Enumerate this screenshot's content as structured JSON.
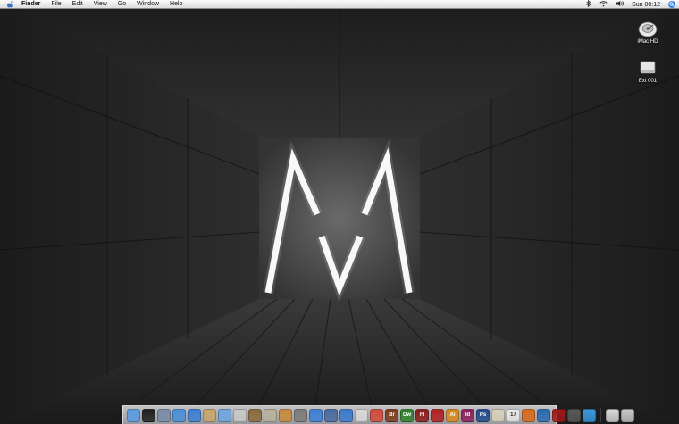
{
  "menubar": {
    "items": [
      "Finder",
      "File",
      "Edit",
      "View",
      "Go",
      "Window",
      "Help"
    ],
    "clock": "Sun 00:12"
  },
  "desktop": {
    "icons": [
      {
        "label": "iMac HD",
        "icon": "hard-drive-icon"
      },
      {
        "label": "Ext 001",
        "icon": "external-drive-icon"
      }
    ]
  },
  "dock": {
    "apps": [
      {
        "icon": "finder-icon",
        "color": "#5a9be0"
      },
      {
        "icon": "dashboard-icon",
        "color": "#1d1d1d"
      },
      {
        "icon": "preview-icon",
        "color": "#7a8aa8"
      },
      {
        "icon": "safari-icon",
        "color": "#4a8fd8"
      },
      {
        "icon": "ichat-icon",
        "color": "#3b7fd4"
      },
      {
        "icon": "address-book-icon",
        "color": "#caa56a"
      },
      {
        "icon": "itunes-icon",
        "color": "#6fa6e0"
      },
      {
        "icon": "textedit-icon",
        "color": "#c9c9c9"
      },
      {
        "icon": "iphoto-icon",
        "color": "#8a6a3a"
      },
      {
        "icon": "imovie-icon",
        "color": "#b8b29a"
      },
      {
        "icon": "garageband-icon",
        "color": "#c98a3a"
      },
      {
        "icon": "system-preferences-icon",
        "color": "#7c7c7c"
      },
      {
        "icon": "itunes-note-icon",
        "color": "#3d7fd6"
      },
      {
        "icon": "app-store-icon",
        "color": "#4a6aa0"
      },
      {
        "icon": "quicktime-icon",
        "color": "#3a7acc"
      },
      {
        "icon": "script-editor-icon",
        "color": "#d8d8d8"
      },
      {
        "icon": "pdf-icon",
        "color": "#d24a3a",
        "label": ""
      },
      {
        "icon": "bridge-icon",
        "color": "#7a3a1a",
        "label": "Br"
      },
      {
        "icon": "dreamweaver-icon",
        "color": "#2f7f2a",
        "label": "Dw"
      },
      {
        "icon": "flash-icon",
        "color": "#8a1a1a",
        "label": "Fl"
      },
      {
        "icon": "acrobat-icon",
        "color": "#b02020",
        "label": ""
      },
      {
        "icon": "illustrator-icon",
        "color": "#d68a1a",
        "label": "Ai"
      },
      {
        "icon": "indesign-icon",
        "color": "#8a1f5a",
        "label": "Id"
      },
      {
        "icon": "photoshop-icon",
        "color": "#1f4a8a",
        "label": "Ps"
      },
      {
        "icon": "fontbook-icon",
        "color": "#d8d0b8",
        "label": ""
      },
      {
        "icon": "calendar-icon",
        "color": "#e8e8e8",
        "label": "17"
      },
      {
        "icon": "firefox-icon",
        "color": "#d86a1a",
        "label": ""
      },
      {
        "icon": "network-icon",
        "color": "#2a6ab0",
        "label": ""
      },
      {
        "icon": "terminal-icon",
        "color": "#a01818",
        "label": ""
      },
      {
        "icon": "activity-monitor-icon",
        "color": "#5a5a5a",
        "label": ""
      },
      {
        "icon": "skype-icon",
        "color": "#3a9ae0",
        "label": ""
      }
    ],
    "right": [
      {
        "icon": "downloads-stack-icon",
        "color": "#d8d8d8"
      },
      {
        "icon": "trash-icon",
        "color": "#c8c8c8"
      }
    ]
  }
}
